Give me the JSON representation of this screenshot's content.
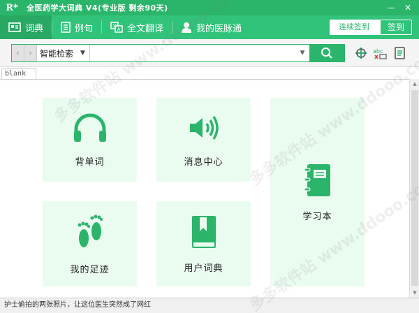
{
  "titlebar": {
    "logo": "R*",
    "title": "全医药学大词典 V4(专业版 剩余90天)",
    "minimize": "—",
    "close": "✕"
  },
  "nav": {
    "items": [
      {
        "label": "词典",
        "icon": "dictionary-icon"
      },
      {
        "label": "例句",
        "icon": "book-icon"
      },
      {
        "label": "全文翻译",
        "icon": "translate-icon"
      },
      {
        "label": "我的医脉通",
        "icon": "user-icon"
      }
    ],
    "checkin_label": "连续签到",
    "checkin_button": "签到"
  },
  "search": {
    "back": "‹",
    "forward": "›",
    "mode": "智能检索",
    "query": "",
    "button_icon": "search-icon"
  },
  "tab": {
    "label": "blank"
  },
  "tiles": [
    {
      "label": "背单词",
      "icon": "headphones-icon"
    },
    {
      "label": "消息中心",
      "icon": "speaker-icon"
    },
    {
      "label": "学习本",
      "icon": "notebook-icon"
    },
    {
      "label": "我的足迹",
      "icon": "footprints-icon"
    },
    {
      "label": "用户词典",
      "icon": "bookmark-book-icon"
    }
  ],
  "status": {
    "text": "护士偷拍的两张照片，让这位医生突然成了网红"
  },
  "watermark": {
    "text": "多多软件站 www.ddooo.com"
  },
  "colors": {
    "brand": "#2bb56a",
    "tile_bg": "#eafbf0"
  }
}
